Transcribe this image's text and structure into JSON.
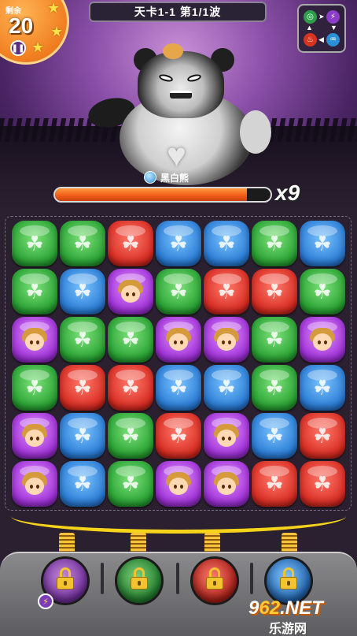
{
  "hud": {
    "moves_label": "剩余",
    "moves_count": "20",
    "pause_icon": "pause-icon",
    "stage_title": "天卡1-1 第1/1波"
  },
  "element_chart": {
    "icons": [
      "wind-icon",
      "lightning-icon",
      "fire-icon",
      "water-icon"
    ]
  },
  "boss": {
    "name": "黑白熊",
    "element_icon": "water-icon",
    "hp_fraction": 0.89,
    "hp_multiplier": "x9"
  },
  "board": {
    "rows": [
      [
        "green",
        "green",
        "red",
        "blue",
        "blue",
        "green",
        "blue"
      ],
      [
        "green",
        "blue",
        "purple",
        "green",
        "red",
        "red",
        "green"
      ],
      [
        "purple",
        "green",
        "green",
        "purple",
        "purple",
        "green",
        "purple"
      ],
      [
        "green",
        "red",
        "red",
        "blue",
        "blue",
        "green",
        "blue"
      ],
      [
        "purple",
        "blue",
        "green",
        "red",
        "purple",
        "blue",
        "red"
      ],
      [
        "purple",
        "blue",
        "green",
        "purple",
        "purple",
        "red",
        "red"
      ]
    ],
    "colors": {
      "green": "#2aa334",
      "blue": "#2b7dd6",
      "red": "#d92d23",
      "purple": "#a032d8"
    }
  },
  "heroes": [
    {
      "color": "purple",
      "locked": true,
      "badge": "lightning-icon"
    },
    {
      "color": "green",
      "locked": true
    },
    {
      "color": "red",
      "locked": true
    },
    {
      "color": "blue",
      "locked": true
    }
  ],
  "watermark": {
    "main_prefix": "9",
    "main_highlight": "62",
    "main_suffix": ".NET",
    "sub": "乐游网"
  }
}
